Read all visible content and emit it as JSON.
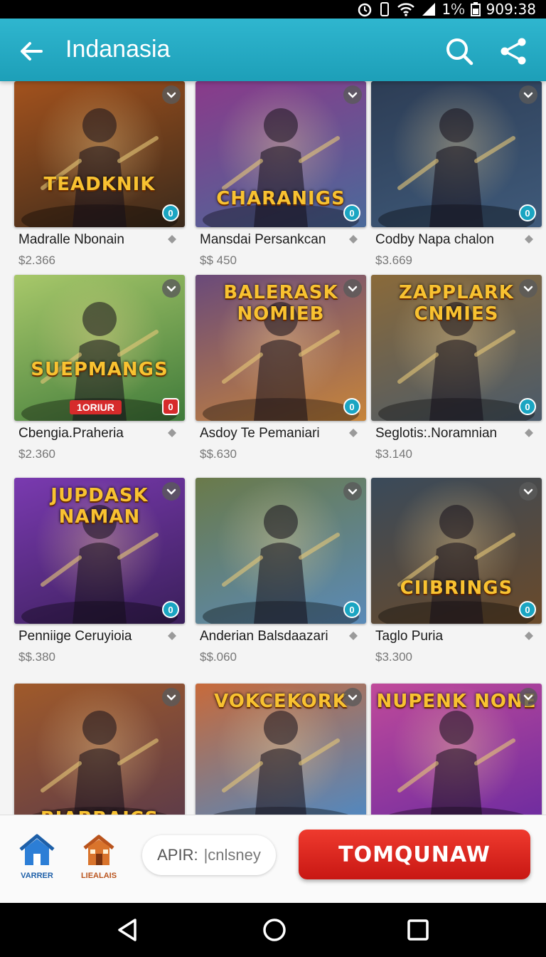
{
  "status_bar": {
    "battery_text": "1⁰⁄₀",
    "time": "909:38"
  },
  "app_bar": {
    "title": "Indanasia",
    "back_icon": "arrow-left-icon",
    "search_icon": "search-icon",
    "share_icon": "share-icon"
  },
  "accent_color": "#1d9fb8",
  "cards": [
    {
      "logo": "TEADKNIK",
      "title": "Madralle Nbonain",
      "price": "$2.366",
      "badge": "0",
      "palette": [
        "#3a2a1c",
        "#a3521d"
      ]
    },
    {
      "logo": "CHARANIGS",
      "title": "Mansdai Persankcan",
      "price": "$$ 450",
      "badge": "0",
      "palette": [
        "#4a6a9a",
        "#8a3a8a"
      ]
    },
    {
      "logo": "",
      "title": "Codby Napa chalon",
      "price": "$3.669",
      "badge": "0",
      "palette": [
        "#3f5a7a",
        "#2d3d55"
      ]
    },
    {
      "logo": "SUEPMANGS",
      "title": "Cbengia.Praheria",
      "price": "$2.360",
      "badge": "0",
      "tag": "1ORIUR",
      "palette": [
        "#3f7a3a",
        "#a8c86a"
      ]
    },
    {
      "logo": "BALERASK NOMIEB",
      "title": "Asdoy Te Pemaniari",
      "price": "$$.630",
      "badge": "0",
      "palette": [
        "#c7853a",
        "#6a4a7a"
      ]
    },
    {
      "logo": "ZAPPLARK CNMIES",
      "title": "Seglotis:.Noramnian",
      "price": "$3.140",
      "badge": "0",
      "palette": [
        "#4a5a6a",
        "#8a6a3a"
      ]
    },
    {
      "logo": "JUPDASK NAMAN",
      "title": "Penniige Ceruyioia",
      "price": "$$.380",
      "badge": "0",
      "palette": [
        "#3a1f5a",
        "#7a3ab0"
      ]
    },
    {
      "logo": "",
      "title": "Anderian Balsdaazari",
      "price": "$$.060",
      "badge": "0",
      "palette": [
        "#5a8ab8",
        "#6a7a4a"
      ]
    },
    {
      "logo": "CIIBRINGS",
      "title": "Taglo Puria",
      "price": "$3.300",
      "badge": "0",
      "palette": [
        "#6a4a2a",
        "#3a4a5a"
      ]
    },
    {
      "logo": "BIABBAICS",
      "title": "",
      "price": "",
      "badge": "",
      "palette": [
        "#5a3a4a",
        "#a05a2a"
      ]
    },
    {
      "logo": "VOKCEKORK",
      "title": "",
      "price": "",
      "badge": "",
      "palette": [
        "#4a8ac8",
        "#c86a3a"
      ]
    },
    {
      "logo": "NUPENK NONE",
      "title": "",
      "price": "",
      "badge": "",
      "palette": [
        "#6a2aa0",
        "#c04a9a"
      ]
    }
  ],
  "bottom_bar": {
    "home_label": "VARRER",
    "shop_label": "LIEALAIS",
    "api_label": "APIR:",
    "api_value": "|cnlsney",
    "cta_label": "TOMQUNAW"
  }
}
